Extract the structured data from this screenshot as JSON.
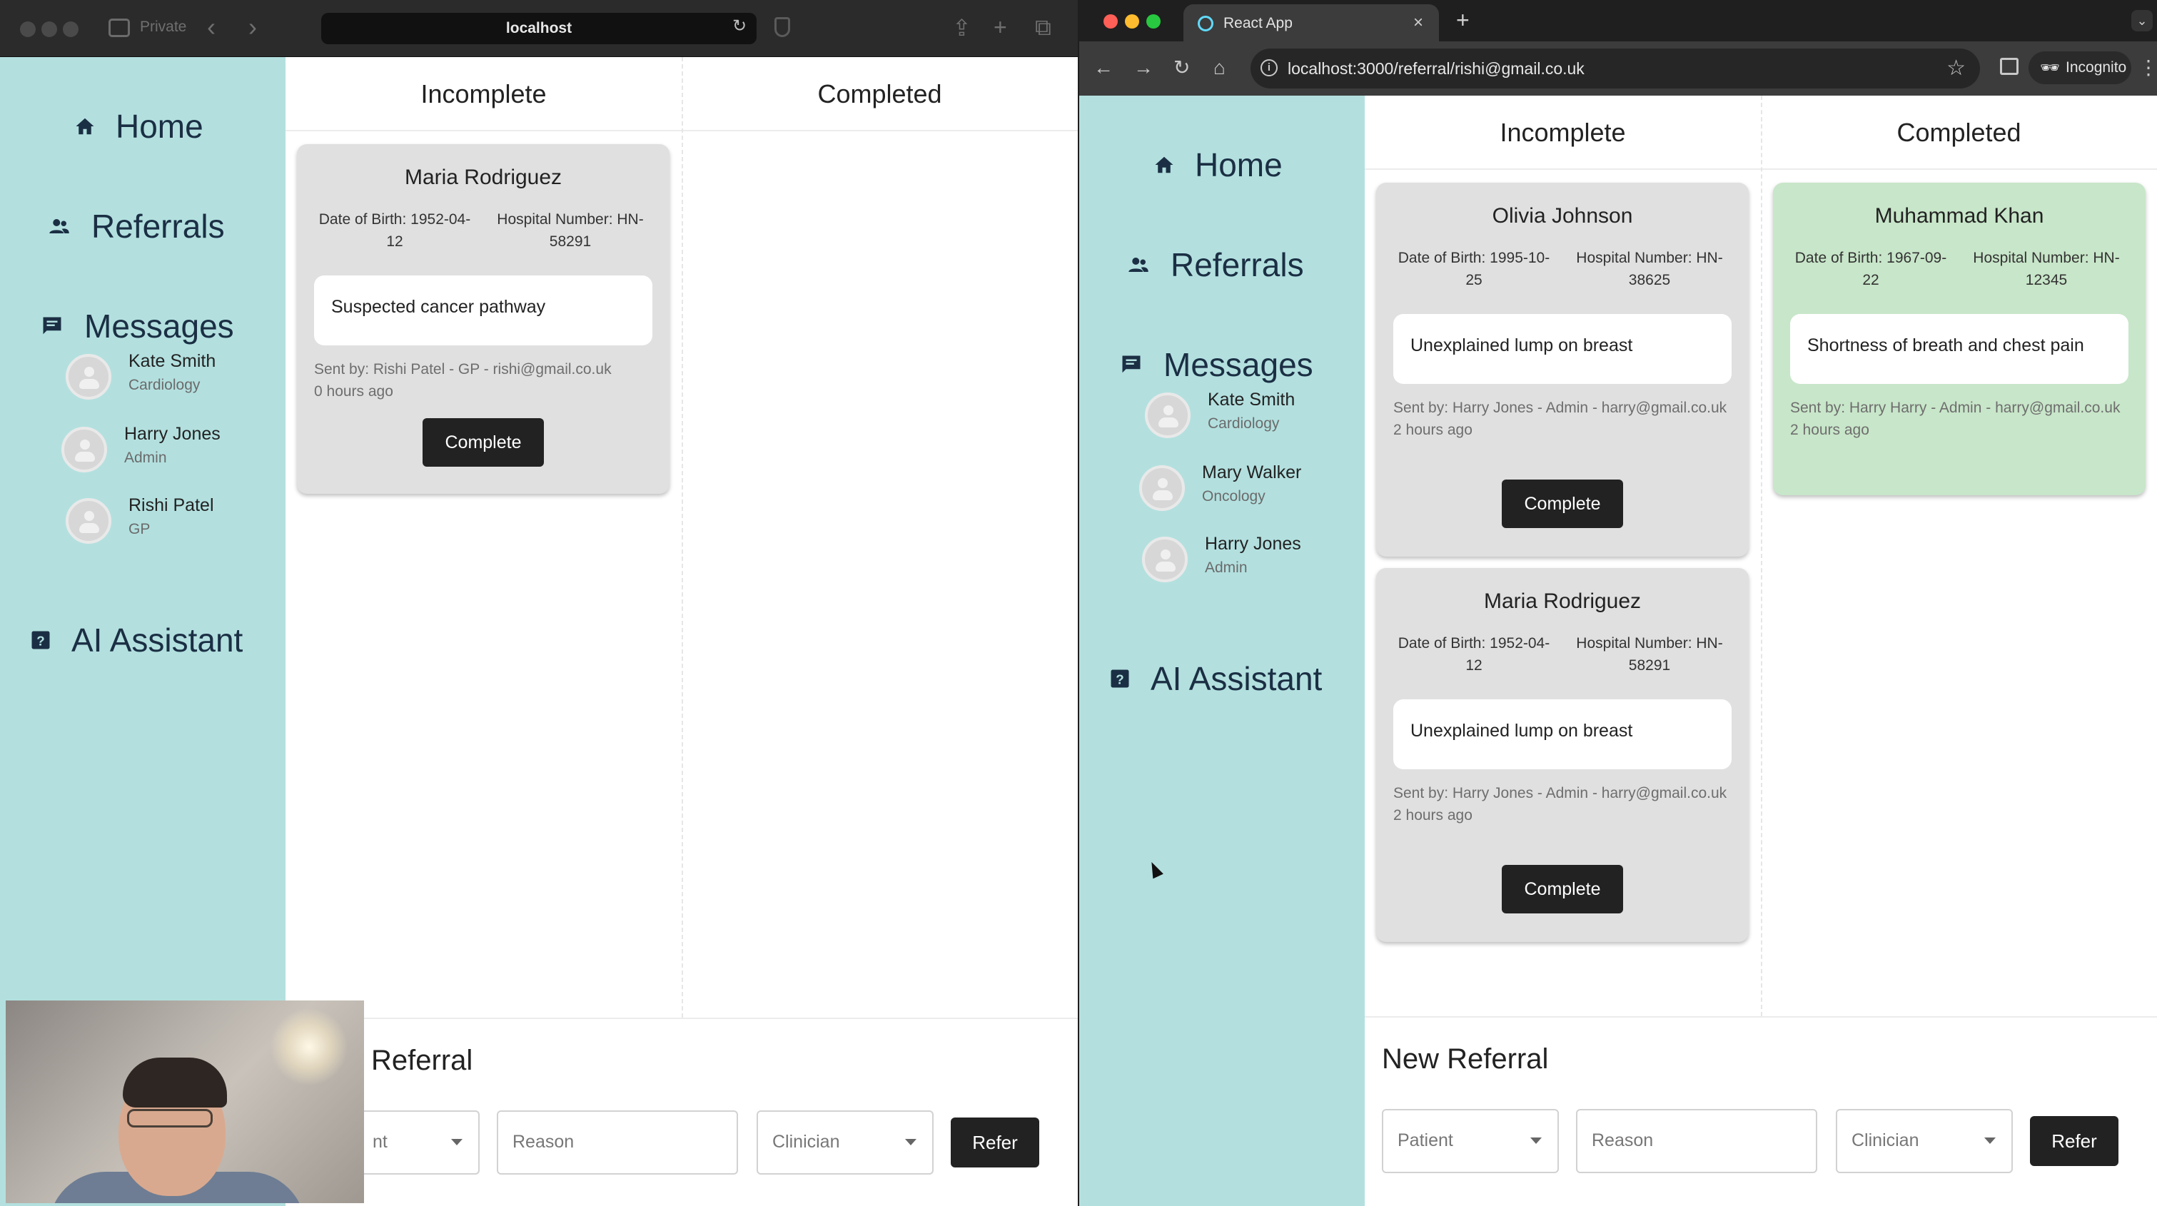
{
  "left_window": {
    "browser": {
      "private_label": "Private",
      "url": "localhost"
    },
    "nav": {
      "home": "Home",
      "referrals": "Referrals",
      "messages": "Messages",
      "ai_assistant": "AI Assistant"
    },
    "contacts": [
      {
        "name": "Kate Smith",
        "role": "Cardiology"
      },
      {
        "name": "Harry Jones",
        "role": "Admin"
      },
      {
        "name": "Rishi Patel",
        "role": "GP"
      }
    ],
    "columns": {
      "incomplete": "Incomplete",
      "completed": "Completed"
    },
    "incomplete_cards": [
      {
        "name": "Maria Rodriguez",
        "dob": "Date of Birth: 1952-04-12",
        "hospital": "Hospital Number: HN-58291",
        "reason": "Suspected cancer pathway",
        "sent_by": "Sent by: Rishi Patel - GP - rishi@gmail.co.uk",
        "time": "0 hours ago",
        "button": "Complete"
      }
    ],
    "new_referral": {
      "title_visible": "Referral",
      "patient_visible": "nt",
      "reason_placeholder": "Reason",
      "clinician_placeholder": "Clinician",
      "refer_button": "Refer"
    }
  },
  "right_window": {
    "browser": {
      "tab_title": "React App",
      "url": "localhost:3000/referral/rishi@gmail.co.uk",
      "incognito_label": "Incognito"
    },
    "nav": {
      "home": "Home",
      "referrals": "Referrals",
      "messages": "Messages",
      "ai_assistant": "AI Assistant"
    },
    "contacts": [
      {
        "name": "Kate Smith",
        "role": "Cardiology"
      },
      {
        "name": "Mary Walker",
        "role": "Oncology"
      },
      {
        "name": "Harry Jones",
        "role": "Admin"
      }
    ],
    "columns": {
      "incomplete": "Incomplete",
      "completed": "Completed"
    },
    "incomplete_cards": [
      {
        "name": "Olivia Johnson",
        "dob": "Date of Birth: 1995-10-25",
        "hospital": "Hospital Number: HN-38625",
        "reason": "Unexplained lump on breast",
        "sent_by": "Sent by: Harry Jones - Admin - harry@gmail.co.uk",
        "time": "2 hours ago",
        "button": "Complete"
      },
      {
        "name": "Maria Rodriguez",
        "dob": "Date of Birth: 1952-04-12",
        "hospital": "Hospital Number: HN-58291",
        "reason": "Unexplained lump on breast",
        "sent_by": "Sent by: Harry Jones - Admin - harry@gmail.co.uk",
        "time": "2 hours ago",
        "button": "Complete"
      }
    ],
    "completed_cards": [
      {
        "name": "Muhammad Khan",
        "dob": "Date of Birth: 1967-09-22",
        "hospital": "Hospital Number: HN-12345",
        "reason": "Shortness of breath and chest pain",
        "sent_by": "Sent by: Harry Harry - Admin - harry@gmail.co.uk",
        "time": "2 hours ago"
      }
    ],
    "new_referral": {
      "title": "New Referral",
      "patient_placeholder": "Patient",
      "reason_placeholder": "Reason",
      "clinician_placeholder": "Clinician",
      "refer_button": "Refer"
    }
  },
  "colors": {
    "sidebar": "#b3e0df",
    "completed_card": "#c8e6c9",
    "incomplete_card": "#e0e0e0",
    "button": "#222222"
  }
}
